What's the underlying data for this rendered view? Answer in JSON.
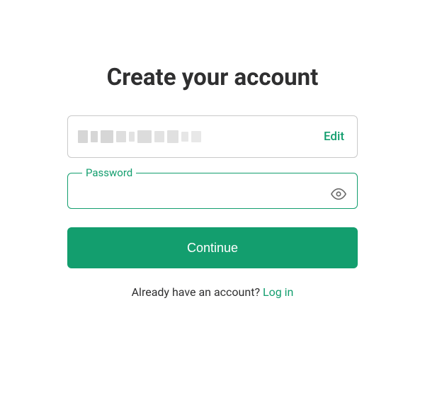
{
  "title": "Create your account",
  "email": {
    "edit_label": "Edit"
  },
  "password": {
    "label": "Password",
    "value": ""
  },
  "continue_label": "Continue",
  "footer": {
    "prompt": "Already have an account?",
    "login_label": "Log in"
  }
}
